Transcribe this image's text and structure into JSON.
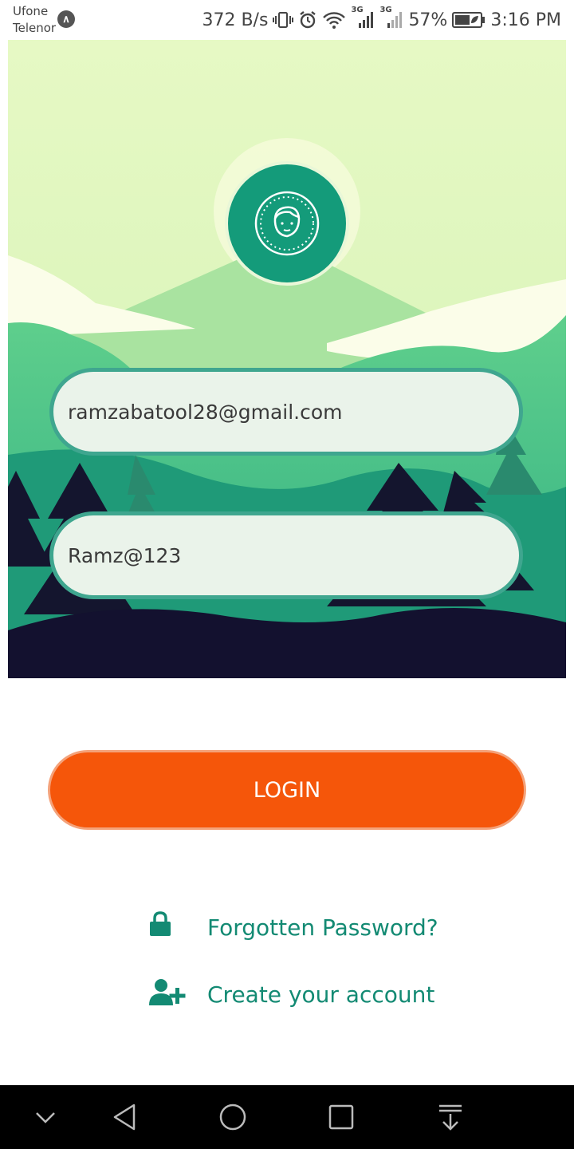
{
  "status_bar": {
    "carrier_1": "Ufone",
    "carrier_2": "Telenor",
    "net_speed": "372 B/s",
    "signal_type_1": "3G",
    "signal_type_2": "3G",
    "battery": "57%",
    "time": "3:16 PM"
  },
  "form": {
    "email_value": "ramzabatool28@gmail.com",
    "password_value": "Ramz@123"
  },
  "actions": {
    "login_label": "LOGIN",
    "forgot_label": "Forgotten Password?",
    "create_label": "Create your account"
  },
  "colors": {
    "primary_green": "#149b7a",
    "login_orange": "#f5560a",
    "link_green": "#138a73"
  },
  "icons": [
    "user-face-icon",
    "lock-icon",
    "add-user-icon",
    "back-icon",
    "home-icon",
    "recents-icon",
    "collapse-icon",
    "notification-pull-icon"
  ]
}
